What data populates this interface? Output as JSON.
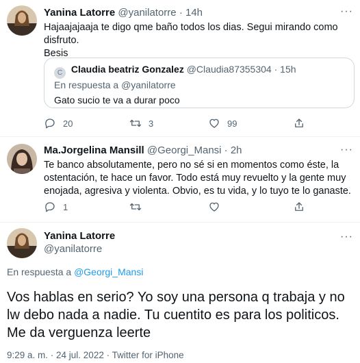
{
  "tweet1": {
    "name": "Yanina Latorre",
    "handle": "@yanilatorre",
    "time": "14h",
    "text_line1": "Hajaajajaaja te digo qme baño todos los dias. Segui mirando como disfruto.",
    "text_line2": "Besis",
    "quote": {
      "avatar_letter": "C",
      "name": "Claudia beatriz Gonzalez",
      "handle": "@Claudia87355304",
      "time": "15h",
      "reply_prefix": "En respuesta a",
      "reply_handle": "@yanilatorre",
      "text": "Gato sucio te va a durar poco"
    },
    "replies": "20",
    "retweets": "3",
    "likes": "99"
  },
  "tweet2": {
    "name": "Ma.Jorgelina Mansill",
    "handle": "@Georgi_Mansi",
    "time": "2h",
    "text_line1": "Te banco absolutamente, pero no sé si en momentos como éste, la",
    "text_line2": "ostentación, te hace un favor. Todo está muy revuelto y la gente muy",
    "text_line3": "enojada, agresiva y violenta. Obvio, es tu vida, y lo tuyo te lo ganaste.",
    "replies": "1"
  },
  "main": {
    "name": "Yanina Latorre",
    "handle": "@yanilatorre",
    "reply_prefix": "En respuesta a",
    "reply_handle": "@Georgi_Mansi",
    "text_line1": "Vos hablas en serio? Yo soy una persona q trabaja y no",
    "text_line2": "lw debo nada a nadie. Tu cuentito es para los politicos.",
    "text_line3": "Me da verguenza leerte",
    "timestamp": "9:29 a. m. · 24 jul. 2022 · Twitter for iPhone"
  },
  "dot": "·",
  "more_glyph": "···",
  "icons": [
    "reply-icon",
    "retweet-icon",
    "like-icon",
    "share-icon",
    "more-icon"
  ],
  "colors": {
    "accent": "#1d9bf0",
    "muted": "#536471",
    "text": "#0f1419",
    "border": "#cfd9de"
  }
}
